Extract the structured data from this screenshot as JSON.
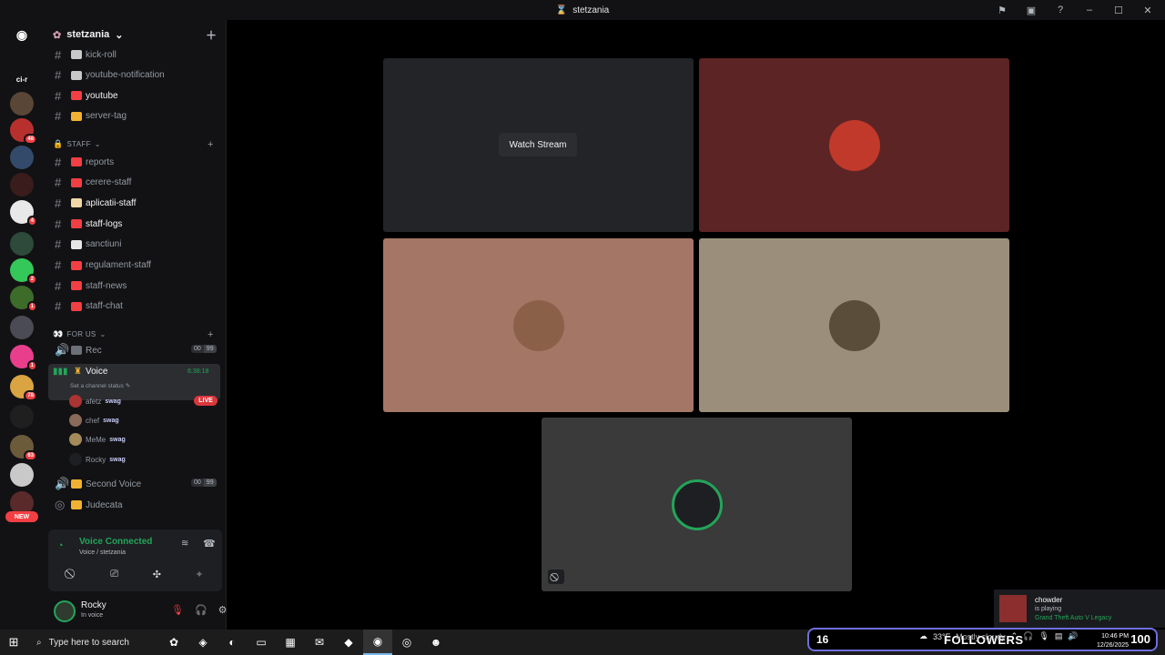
{
  "window": {
    "title": "stetzania"
  },
  "rail": {
    "servers": [
      {
        "label": "ci-r",
        "color": "#121214"
      },
      {
        "label": "",
        "color": "#5a4636"
      },
      {
        "label": "",
        "color": "#b8302e",
        "badge": "48"
      },
      {
        "label": "",
        "color": "#334a6b"
      },
      {
        "label": "",
        "color": "#3a1c1c"
      },
      {
        "label": "",
        "color": "#e8e8e8",
        "badge": "4"
      },
      {
        "label": "",
        "color": "#2d4a3a"
      },
      {
        "label": "",
        "color": "#34c759",
        "badge": "2"
      },
      {
        "label": "",
        "color": "#3d6b2a",
        "badge": "1"
      },
      {
        "label": "",
        "color": "#4b4b55"
      },
      {
        "label": "",
        "color": "#e83e8c",
        "badge": "1"
      },
      {
        "label": "",
        "color": "#d9a441",
        "badge": "78"
      },
      {
        "label": "",
        "color": "#1f1f1f"
      },
      {
        "label": "",
        "color": "#6b5b3a",
        "badge": "63"
      },
      {
        "label": "",
        "color": "#c9c9c9"
      },
      {
        "label": "",
        "color": "#5a2a2a"
      }
    ],
    "new_label": "NEW"
  },
  "sidebar": {
    "guild_name": "stetzania",
    "channels_top": [
      {
        "name": "kick-roll",
        "emoji_color": "#c9c9c9",
        "bright": false
      },
      {
        "name": "youtube-notification",
        "emoji_color": "#c9c9c9",
        "bright": false
      },
      {
        "name": "youtube",
        "emoji_color": "#f23f43",
        "bright": true
      },
      {
        "name": "server-tag",
        "emoji_color": "#f0b232",
        "bright": false
      }
    ],
    "staff_category": "STAFF",
    "staff_channels": [
      {
        "name": "reports",
        "emoji_color": "#f23f43",
        "bright": false
      },
      {
        "name": "cerere-staff",
        "emoji_color": "#f23f43",
        "bright": false
      },
      {
        "name": "aplicatii-staff",
        "emoji_color": "#f0d7a7",
        "bright": true
      },
      {
        "name": "staff-logs",
        "emoji_color": "#f23f43",
        "bright": true
      },
      {
        "name": "sanctiuni",
        "emoji_color": "#e6e6e6",
        "bright": false
      },
      {
        "name": "regulament-staff",
        "emoji_color": "#f23f43",
        "bright": false
      },
      {
        "name": "staff-news",
        "emoji_color": "#f23f43",
        "bright": false
      },
      {
        "name": "staff-chat",
        "emoji_color": "#f23f43",
        "bright": false
      }
    ],
    "forus_category": "FOR US",
    "rec_channel": {
      "name": "Rec",
      "count_a": "00",
      "count_b": "99"
    },
    "voice_channel": {
      "name": "Voice",
      "timer": "6:38:18",
      "status": "Set a channel status"
    },
    "voice_users": [
      {
        "name": "afetz",
        "tag": "swag",
        "color": "#a33",
        "live": "LIVE"
      },
      {
        "name": "chef",
        "tag": "swag",
        "color": "#8a6a5a"
      },
      {
        "name": "MeMe",
        "tag": "swag",
        "color": "#a58a5a"
      },
      {
        "name": "Rocky",
        "tag": "swag",
        "color": "#1e1f22"
      }
    ],
    "second_voice": {
      "name": "Second Voice",
      "count_a": "00",
      "count_b": "99"
    },
    "judecata": {
      "name": "Judecata"
    }
  },
  "voice_panel": {
    "status": "Voice Connected",
    "location": "Voice / stetzania"
  },
  "user": {
    "name": "Rocky",
    "status": "In voice"
  },
  "stage": {
    "tiles": [
      {
        "bg": "#232428",
        "watch_label": "Watch Stream"
      },
      {
        "bg": "#5c2424",
        "avatar_color": "#c0392b"
      },
      {
        "bg": "#a47666",
        "avatar_color": "#8a6048"
      },
      {
        "bg": "#9b8f7c",
        "avatar_color": "#5a4e3a"
      },
      {
        "bg": "#3a3a3a",
        "avatar_color": "#1e1f22"
      }
    ]
  },
  "notification": {
    "user": "chowder",
    "action": "is playing",
    "game": "Grand Theft Auto V Legacy"
  },
  "taskbar": {
    "search_placeholder": "Type here to search",
    "followers_count": "16",
    "followers_label": "FOLLOWERS",
    "followers_goal": "100",
    "temp": "33°F",
    "weather": "Mostly cloudy",
    "time": "10:46 PM",
    "date": "12/26/2025"
  }
}
